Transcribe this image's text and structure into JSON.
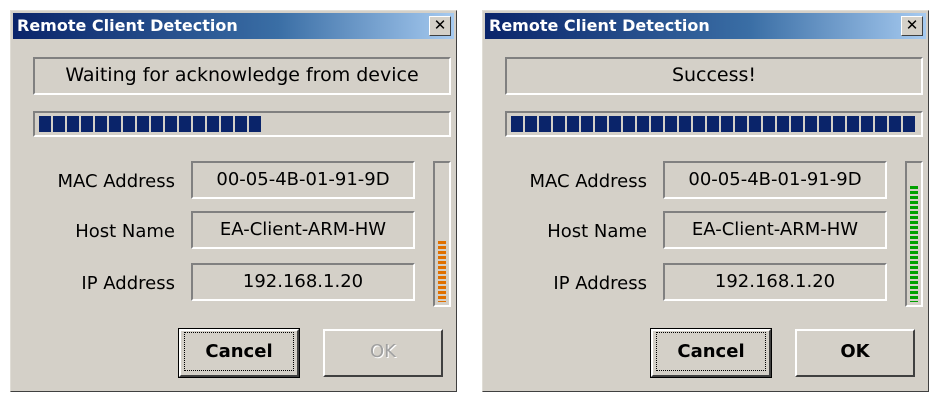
{
  "dialogs": [
    {
      "title": "Remote Client Detection",
      "status": "Waiting for acknowledge from device",
      "progress_fraction": 0.56,
      "fields": {
        "mac_label": "MAC Address",
        "mac_value": "00-05-4B-01-91-9D",
        "host_label": "Host Name",
        "host_value": "EA-Client-ARM-HW",
        "ip_label": "IP Address",
        "ip_value": "192.168.1.20"
      },
      "meter": {
        "level": 0.45,
        "color": "#e07000"
      },
      "cancel_label": "Cancel",
      "ok_label": "OK",
      "ok_enabled": false
    },
    {
      "title": "Remote Client Detection",
      "status": "Success!",
      "progress_fraction": 1.0,
      "fields": {
        "mac_label": "MAC Address",
        "mac_value": "00-05-4B-01-91-9D",
        "host_label": "Host Name",
        "host_value": "EA-Client-ARM-HW",
        "ip_label": "IP Address",
        "ip_value": "192.168.1.20"
      },
      "meter": {
        "level": 0.85,
        "color": "#00a000"
      },
      "cancel_label": "Cancel",
      "ok_label": "OK",
      "ok_enabled": true
    }
  ],
  "icons": {
    "close": "close-icon"
  },
  "colors": {
    "titlebar": "#0a246a",
    "progress": "#0a246a",
    "face": "#d4d0c8"
  }
}
